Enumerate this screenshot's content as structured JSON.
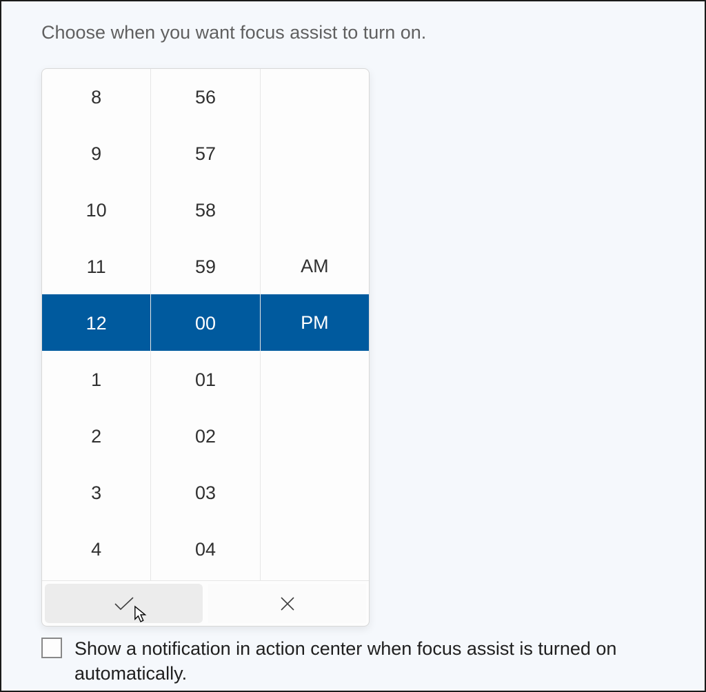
{
  "header": {
    "instruction": "Choose when you want focus assist to turn on."
  },
  "time_picker": {
    "hour_column": [
      "8",
      "9",
      "10",
      "11",
      "12",
      "1",
      "2",
      "3",
      "4"
    ],
    "minute_column": [
      "56",
      "57",
      "58",
      "59",
      "00",
      "01",
      "02",
      "03",
      "04"
    ],
    "ampm_column": [
      "AM",
      "PM"
    ],
    "selected_hour": "12",
    "selected_minute": "00",
    "selected_ampm": "PM",
    "confirm_icon": "check-icon",
    "cancel_icon": "close-icon"
  },
  "checkbox": {
    "checked": false,
    "label": "Show a notification in action center when focus assist is turned on automatically."
  },
  "colors": {
    "highlight": "#005a9e",
    "page_bg": "#f5f8fc"
  }
}
